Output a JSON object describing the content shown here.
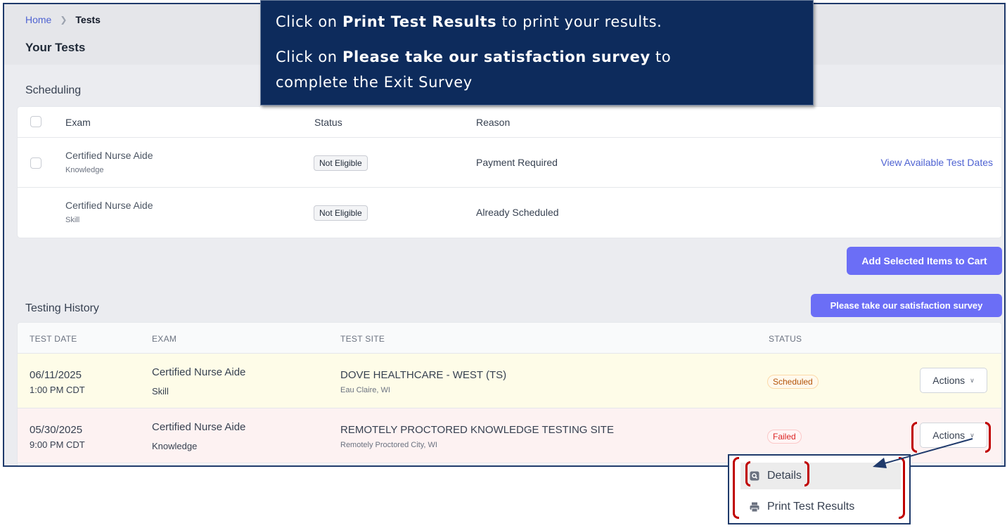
{
  "breadcrumb": {
    "home": "Home",
    "current": "Tests"
  },
  "page_title": "Your Tests",
  "callout": {
    "line1_pre": "Click on ",
    "line1_bold": "Print Test Results",
    "line1_post": " to print your results.",
    "line2_pre": "Click on ",
    "line2_bold": "Please take our satisfaction survey",
    "line2_post": " to",
    "line3": "complete the Exit Survey"
  },
  "scheduling": {
    "title": "Scheduling",
    "headers": {
      "exam": "Exam",
      "status": "Status",
      "reason": "Reason"
    },
    "rows": [
      {
        "exam": "Certified Nurse Aide",
        "type": "Knowledge",
        "status": "Not Eligible",
        "reason": "Payment Required",
        "action": "View Available Test Dates"
      },
      {
        "exam": "Certified Nurse Aide",
        "type": "Skill",
        "status": "Not Eligible",
        "reason": "Already Scheduled"
      }
    ],
    "add_button": "Add Selected Items to Cart"
  },
  "history": {
    "title": "Testing History",
    "survey_button": "Please take our satisfaction survey",
    "headers": {
      "date": "TEST DATE",
      "exam": "EXAM",
      "site": "TEST SITE",
      "status": "STATUS"
    },
    "rows": [
      {
        "date": "06/11/2025",
        "time": "1:00 PM CDT",
        "exam": "Certified Nurse Aide",
        "type": "Skill",
        "site": "DOVE HEALTHCARE - WEST (TS)",
        "location": "Eau Claire, WI",
        "status": "Scheduled",
        "action": "Actions"
      },
      {
        "date": "05/30/2025",
        "time": "9:00 PM CDT",
        "exam": "Certified Nurse Aide",
        "type": "Knowledge",
        "site": "REMOTELY PROCTORED KNOWLEDGE TESTING SITE",
        "location": "Remotely Proctored City, WI",
        "status": "Failed",
        "action": "Actions"
      }
    ]
  },
  "actions_menu": {
    "details": "Details",
    "print": "Print Test Results"
  },
  "colors": {
    "accent": "#6b6ef6",
    "callout_bg": "#0d2b5c",
    "highlight": "#c00000",
    "link": "#4f63d2"
  }
}
